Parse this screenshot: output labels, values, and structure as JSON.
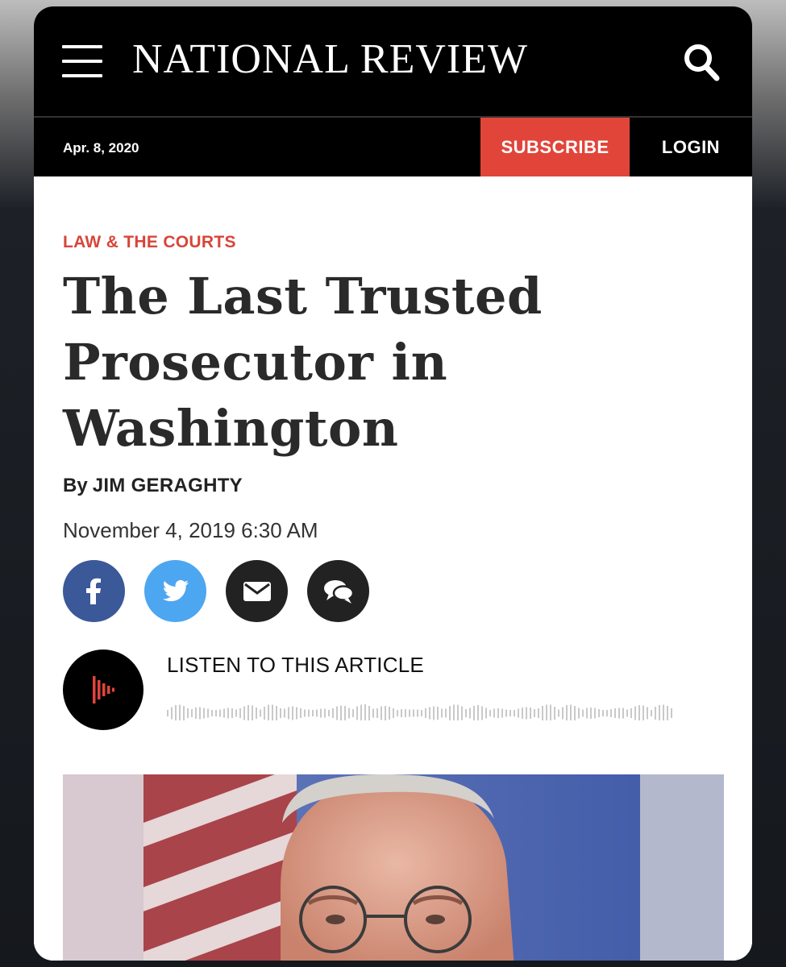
{
  "header": {
    "logo": "NATIONAL REVIEW",
    "menu_icon": "hamburger-menu-icon",
    "search_icon": "search-icon"
  },
  "subheader": {
    "date": "Apr. 8, 2020",
    "subscribe_label": "SUBSCRIBE",
    "login_label": "LOGIN"
  },
  "article": {
    "category": "LAW & THE COURTS",
    "headline_lines": [
      "The Last Trusted",
      "Prosecutor in",
      "Washington"
    ],
    "byline_prefix": "By",
    "author": "JIM GERAGHTY",
    "published": "November 4, 2019 6:30 AM"
  },
  "share": {
    "buttons": [
      "facebook-icon",
      "twitter-icon",
      "email-icon",
      "comments-icon"
    ]
  },
  "audio": {
    "label": "LISTEN TO THIS ARTICLE",
    "icon": "audio-play-icon"
  },
  "colors": {
    "accent": "#e1453a",
    "facebook": "#3b5898",
    "twitter": "#4da6f0",
    "dark": "#222222"
  }
}
